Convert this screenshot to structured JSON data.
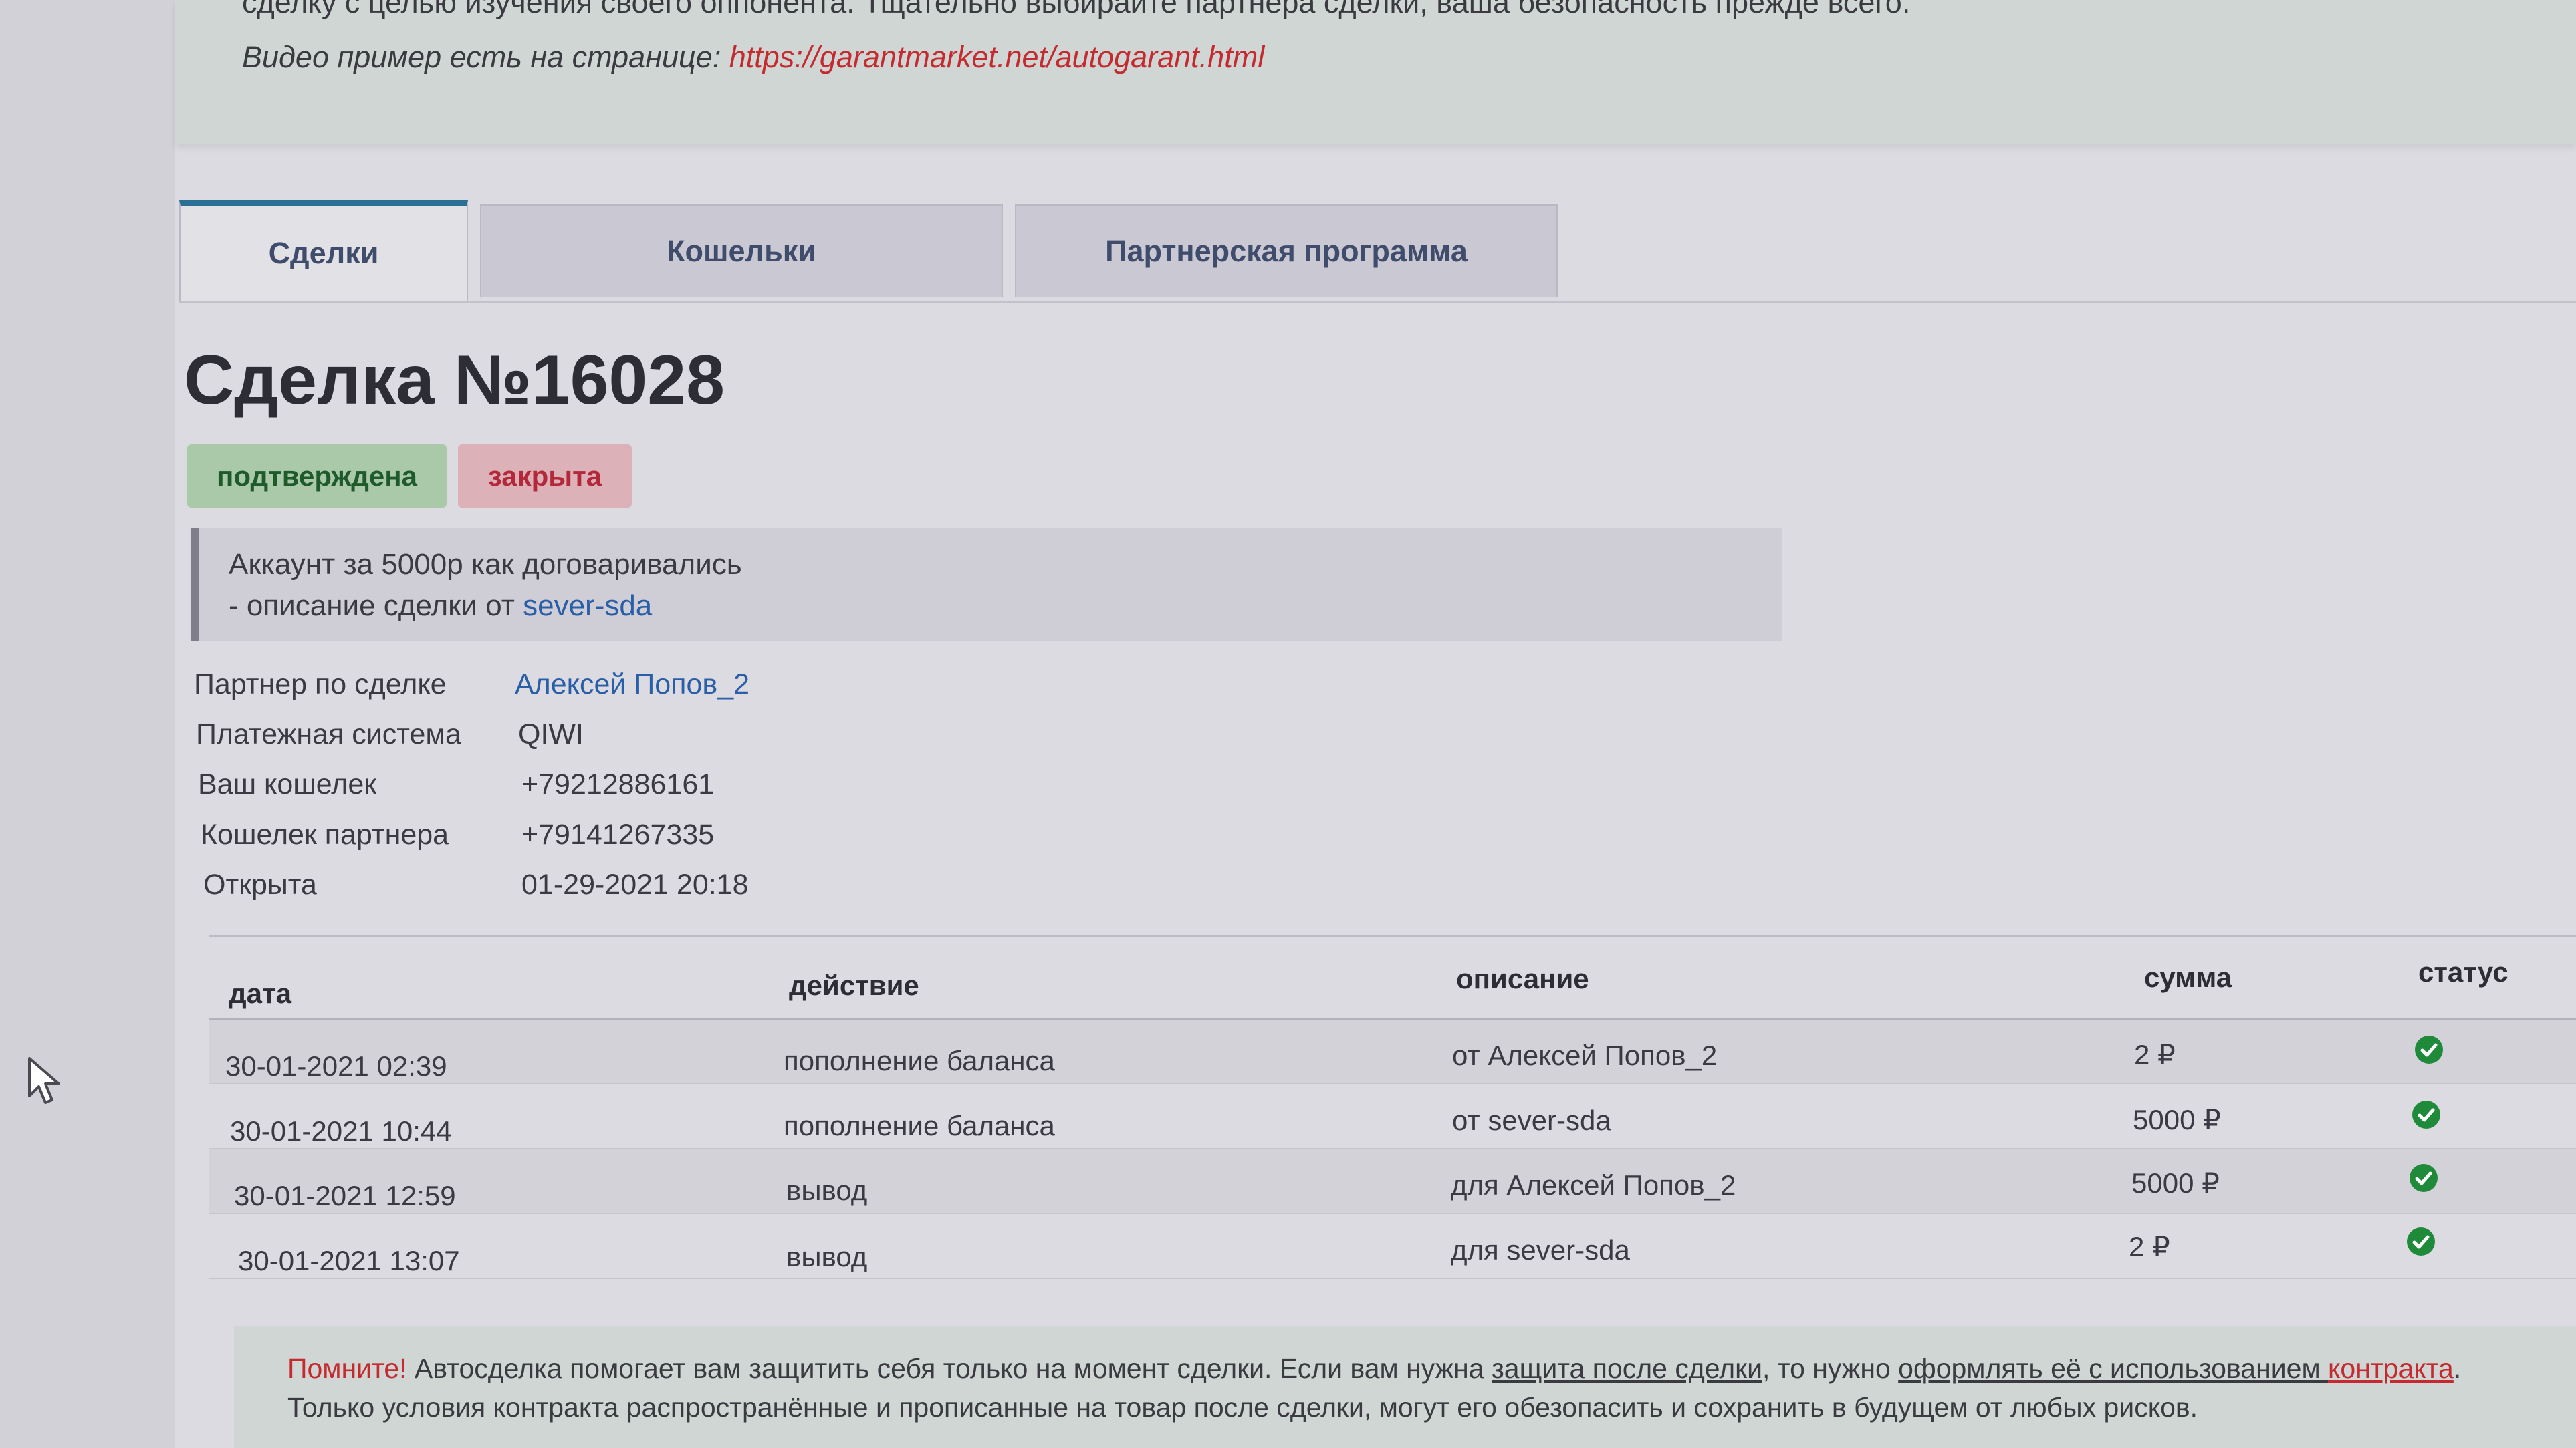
{
  "top_notice": {
    "line1": "сделку с целью изучения своего оппонента. Тщательно выбирайте партнера сделки, ваша безопасность прежде всего.",
    "line2_prefix": "Видео пример есть на странице: ",
    "line2_link": "https://garantmarket.net/autogarant.html"
  },
  "tabs": [
    {
      "label": "Сделки"
    },
    {
      "label": "Кошельки"
    },
    {
      "label": "Партнерская программа"
    }
  ],
  "deal": {
    "title": "Сделка №16028",
    "badges": {
      "confirmed": "подтверждена",
      "closed": "закрыта"
    },
    "description": {
      "text": "Аккаунт за 5000р как договаривались",
      "author_prefix": "- описание сделки от ",
      "author": "sever-sda"
    },
    "info": [
      {
        "label": "Партнер по сделке",
        "value": "Алексей Попов_2"
      },
      {
        "label": "Платежная система",
        "value": "QIWI"
      },
      {
        "label": "Ваш кошелек",
        "value": "+79212886161"
      },
      {
        "label": "Кошелек партнера",
        "value": "+79141267335"
      },
      {
        "label": "Открыта",
        "value": "01-29-2021 20:18"
      }
    ]
  },
  "transactions": {
    "headers": {
      "date": "дата",
      "action": "действие",
      "description": "описание",
      "sum": "сумма",
      "status": "статус"
    },
    "rows": [
      {
        "date": "30-01-2021 02:39",
        "action": "пополнение баланса",
        "description": "от Алексей Попов_2",
        "sum": "2 ₽",
        "status": "check-icon"
      },
      {
        "date": "30-01-2021 10:44",
        "action": "пополнение баланса",
        "description": "от sever-sda",
        "sum": "5000 ₽",
        "status": "check-icon"
      },
      {
        "date": "30-01-2021 12:59",
        "action": "вывод",
        "description": "для Алексей Попов_2",
        "sum": "5000 ₽",
        "status": "check-icon"
      },
      {
        "date": "30-01-2021 13:07",
        "action": "вывод",
        "description": "для sever-sda",
        "sum": "2 ₽",
        "status": "check-icon"
      }
    ]
  },
  "bottom_notice": {
    "remember": "Помните!",
    "line1_a": " Автосделка помогает вам защитить себя только на момент сделки. Если вам нужна ",
    "link1": "защита после сделки",
    "line1_b": ", то нужно ",
    "link2": "оформлять её с использованием ",
    "link3": "контракта",
    "line1_c": ".",
    "line2": "Только условия контракта распространённые и прописанные на товар после сделки, могут его обезопасить и сохранить в будущем от любых рисков."
  },
  "colors": {
    "accent": "#2a6f94",
    "link": "#2a5fa8",
    "warning": "#c42a2f",
    "success": "#1f8a3a"
  }
}
